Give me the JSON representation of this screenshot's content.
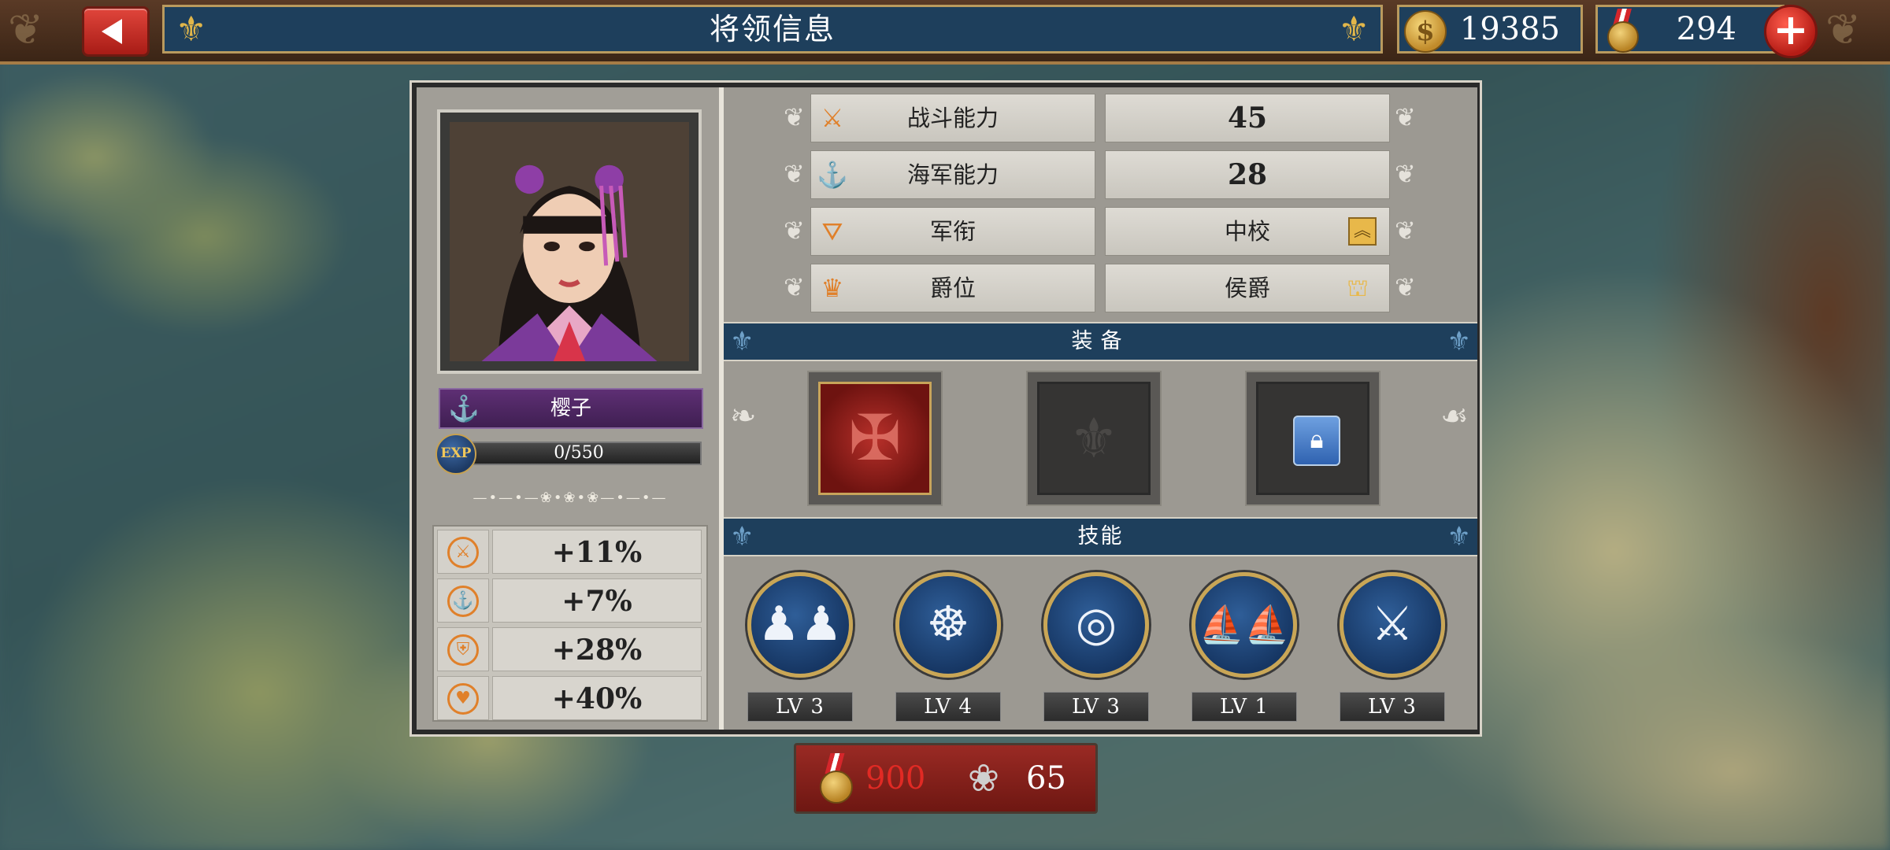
{
  "header": {
    "title": "将领信息"
  },
  "resources": {
    "coins": "19385",
    "medals": "294"
  },
  "general": {
    "name": "樱子",
    "exp": "0/550",
    "exp_label": "EXP",
    "bonuses": [
      {
        "icon": "sword-bonus-icon",
        "value": "+11%"
      },
      {
        "icon": "anchor-bonus-icon",
        "value": "+7%"
      },
      {
        "icon": "shield-bonus-icon",
        "value": "+28%"
      },
      {
        "icon": "heart-bonus-icon",
        "value": "+40%"
      }
    ]
  },
  "stats": [
    {
      "label": "战斗能力",
      "value": "45",
      "icon": "crossed-swords-icon"
    },
    {
      "label": "海军能力",
      "value": "28",
      "icon": "anchor-icon"
    },
    {
      "label": "军衔",
      "value": "中校",
      "icon": "rank-chevron-icon"
    },
    {
      "label": "爵位",
      "value": "侯爵",
      "icon": "crown-icon"
    }
  ],
  "sections": {
    "equipment": "装备",
    "skills": "技能"
  },
  "equipment_slots": [
    {
      "state": "equipped",
      "icon": "red-crest-icon"
    },
    {
      "state": "empty",
      "icon": "fleur-placeholder-icon"
    },
    {
      "state": "locked",
      "icon": "lock-icon"
    }
  ],
  "skills": [
    {
      "icon": "soldiers-icon",
      "level": "LV 3"
    },
    {
      "icon": "ship-wheel-icon",
      "level": "LV 4"
    },
    {
      "icon": "target-icon",
      "level": "LV 3"
    },
    {
      "icon": "fleet-icon",
      "level": "LV 1"
    },
    {
      "icon": "crossed-sabers-icon",
      "level": "LV 3"
    }
  ],
  "cost": {
    "medals": "900",
    "flowers": "65"
  },
  "colors": {
    "accent_blue": "#1e3f5c",
    "accent_red": "#c42820",
    "gold": "#e0b24a",
    "orange_icon": "#e0802a"
  }
}
